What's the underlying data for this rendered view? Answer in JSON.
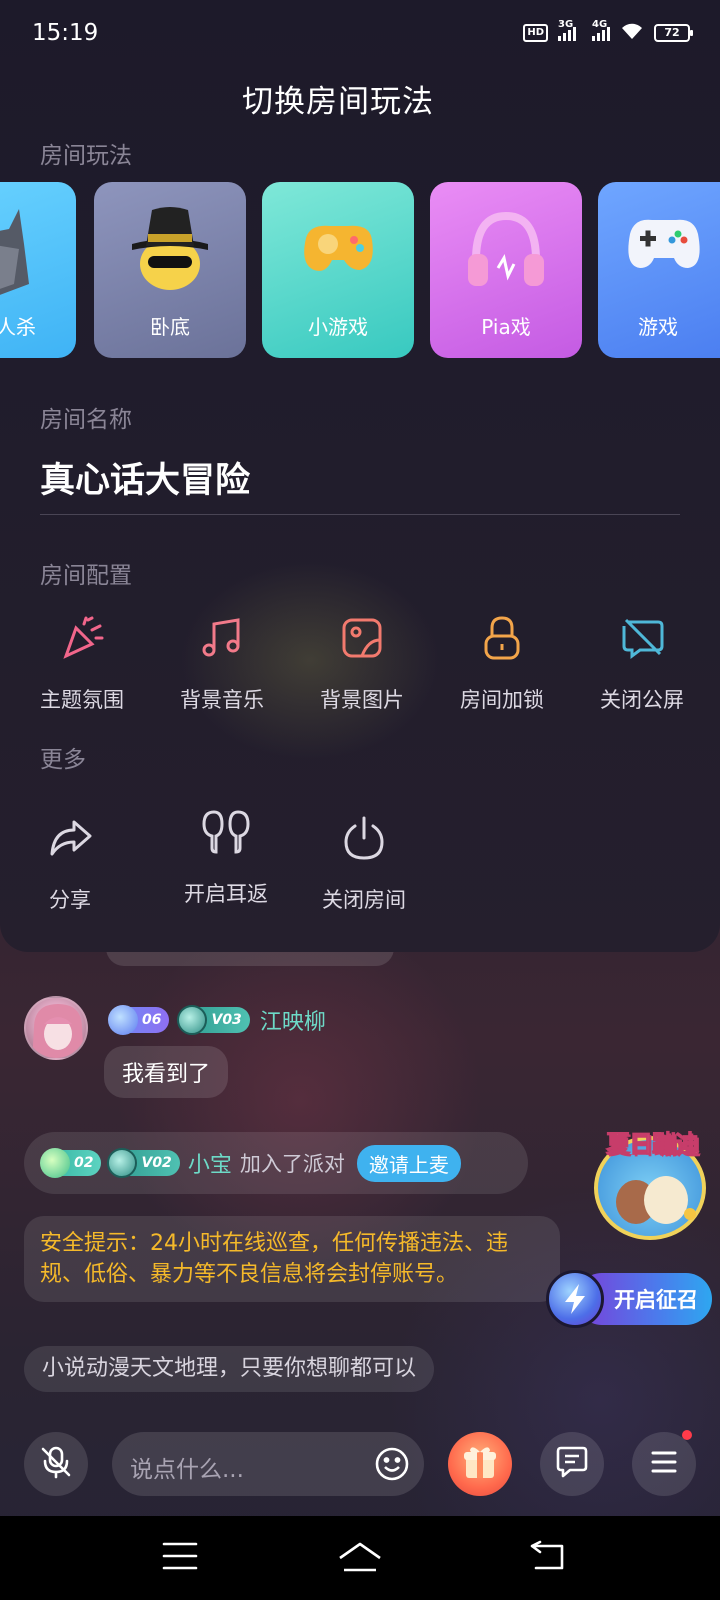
{
  "status_bar": {
    "time": "15:19",
    "hd_label": "HD",
    "net1": "3G",
    "net2": "4G",
    "battery": "72"
  },
  "panel": {
    "title": "切换房间玩法",
    "modes_label": "房间玩法",
    "modes": [
      {
        "label": "人杀",
        "icon": "werewolf-icon",
        "color": "#4fc3f7"
      },
      {
        "label": "卧底",
        "icon": "spy-hat-icon",
        "color": "#7b84b0"
      },
      {
        "label": "小游戏",
        "icon": "gamepad-yellow-icon",
        "color": "#4fd6c6"
      },
      {
        "label": "Pia戏",
        "icon": "headphones-icon",
        "color": "#d46be8"
      },
      {
        "label": "游戏",
        "icon": "controller-icon",
        "color": "#5a8ef5"
      }
    ],
    "name_label": "房间名称",
    "room_name": "真心话大冒险",
    "config_label": "房间配置",
    "config_items": [
      {
        "label": "主题氛围",
        "icon": "party-popper-icon"
      },
      {
        "label": "背景音乐",
        "icon": "music-note-icon"
      },
      {
        "label": "背景图片",
        "icon": "image-icon"
      },
      {
        "label": "房间加锁",
        "icon": "lock-icon"
      },
      {
        "label": "关闭公屏",
        "icon": "chat-off-icon"
      }
    ],
    "more_label": "更多",
    "more_items": [
      {
        "label": "分享",
        "icon": "share-icon"
      },
      {
        "label": "开启耳返",
        "icon": "earbuds-icon"
      },
      {
        "label": "关闭房间",
        "icon": "power-icon"
      }
    ]
  },
  "chat": {
    "message1": {
      "level_badge": "06",
      "vip_badge": "V03",
      "username": "江映柳",
      "text": "我看到了"
    },
    "join": {
      "level_badge": "02",
      "vip_badge": "V02",
      "username": "小宝",
      "action": "加入了派对",
      "invite_label": "邀请上麦"
    },
    "safety_notice": "安全提示：24小时在线巡查，任何传播违法、违规、低俗、暴力等不良信息将会封停账号。",
    "tip": "小说动漫天文地理，只要你想聊都可以"
  },
  "floating": {
    "summer_title": "夏日蹦迪",
    "recruit_label": "开启征召"
  },
  "toolbar": {
    "input_placeholder": "说点什么..."
  }
}
